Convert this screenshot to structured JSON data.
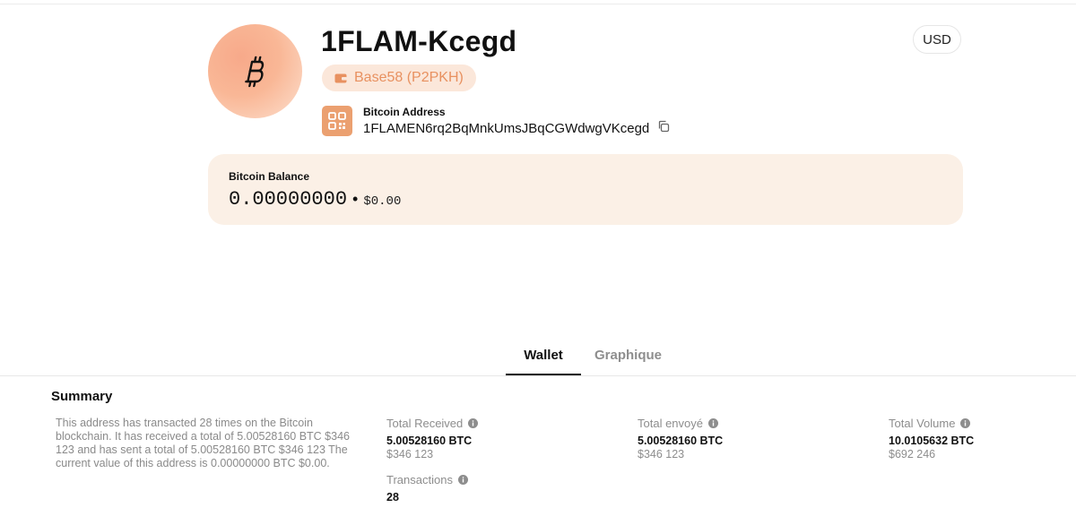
{
  "header": {
    "title": "1FLAM-Kcegd",
    "badge_label": "Base58 (P2PKH)",
    "currency": "USD",
    "address_label": "Bitcoin Address",
    "address": "1FLAMEN6rq2BqMnkUmsJBqCGWdwgVKcegd"
  },
  "balance": {
    "label": "Bitcoin Balance",
    "btc": "0.00000000",
    "separator": "•",
    "usd": "$0.00"
  },
  "tabs": [
    {
      "label": "Wallet",
      "active": true
    },
    {
      "label": "Graphique",
      "active": false
    }
  ],
  "summary": {
    "title": "Summary",
    "description": "This address has transacted 28 times on the Bitcoin blockchain. It has received a total of 5.00528160 BTC $346 123 and has sent a total of 5.00528160 BTC $346 123 The current value of this address is 0.00000000 BTC $0.00.",
    "total_received": {
      "label": "Total Received",
      "btc": "5.00528160 BTC",
      "usd": "$346 123"
    },
    "total_sent": {
      "label": "Total envoyé",
      "btc": "5.00528160 BTC",
      "usd": "$346 123"
    },
    "total_volume": {
      "label": "Total Volume",
      "btc": "10.0105632 BTC",
      "usd": "$692 246"
    },
    "transactions": {
      "label": "Transactions",
      "value": "28"
    }
  },
  "colors": {
    "accent": "#eba070",
    "badge_bg": "#fbe7da",
    "balance_bg": "#fbf0e6"
  },
  "icons": [
    "bitcoin-icon",
    "wallet-icon",
    "qr-code-icon",
    "copy-icon",
    "info-icon"
  ]
}
